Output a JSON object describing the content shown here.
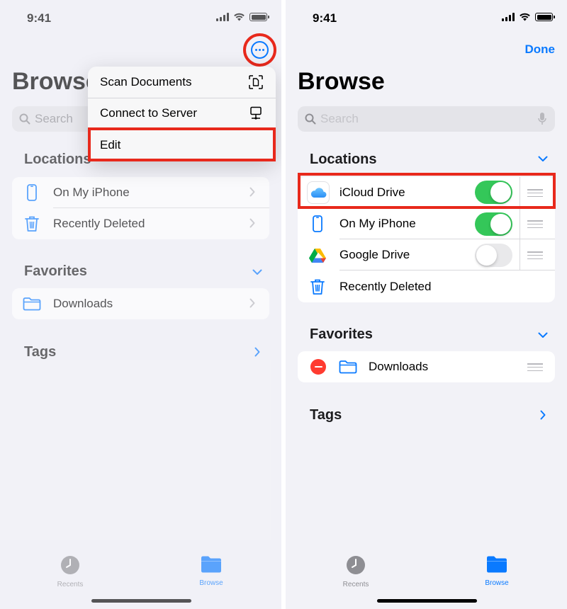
{
  "left": {
    "status_time": "9:41",
    "title": "Browse",
    "search_placeholder": "Search",
    "locations_header": "Locations",
    "locations": [
      {
        "label": "On My iPhone",
        "icon": "iphone-icon"
      },
      {
        "label": "Recently Deleted",
        "icon": "trash-icon"
      }
    ],
    "favorites_header": "Favorites",
    "favorites": [
      {
        "label": "Downloads",
        "icon": "folder-icon"
      }
    ],
    "tags_header": "Tags",
    "menu": {
      "items": [
        {
          "label": "Scan Documents",
          "icon": "scan-document-icon"
        },
        {
          "label": "Connect to Server",
          "icon": "server-icon"
        },
        {
          "label": "Edit"
        }
      ]
    },
    "tabs": [
      {
        "label": "Recents",
        "icon": "clock-icon",
        "active": false
      },
      {
        "label": "Browse",
        "icon": "folder-icon",
        "active": true
      }
    ]
  },
  "right": {
    "status_time": "9:41",
    "done_label": "Done",
    "title": "Browse",
    "search_placeholder": "Search",
    "locations_header": "Locations",
    "locations": [
      {
        "label": "iCloud Drive",
        "icon": "icloud-icon",
        "toggle": "on"
      },
      {
        "label": "On My iPhone",
        "icon": "iphone-icon",
        "toggle": "on"
      },
      {
        "label": "Google Drive",
        "icon": "google-drive-icon",
        "toggle": "off"
      },
      {
        "label": "Recently Deleted",
        "icon": "trash-icon"
      }
    ],
    "favorites_header": "Favorites",
    "favorites": [
      {
        "label": "Downloads",
        "icon": "folder-icon"
      }
    ],
    "tags_header": "Tags",
    "tabs": [
      {
        "label": "Recents",
        "icon": "clock-icon",
        "active": false
      },
      {
        "label": "Browse",
        "icon": "folder-icon",
        "active": true
      }
    ]
  },
  "colors": {
    "accent": "#0a7aff",
    "highlight": "#e8291c",
    "toggle_on": "#34c759",
    "delete": "#ff3b30",
    "background": "#f2f2f7"
  }
}
